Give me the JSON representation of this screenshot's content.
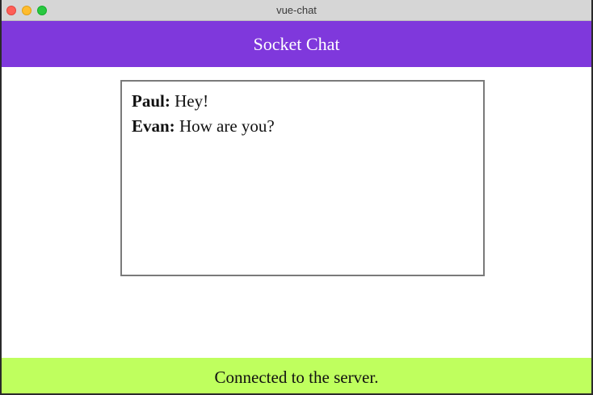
{
  "window": {
    "title": "vue-chat"
  },
  "header": {
    "title": "Socket Chat",
    "background": "#7f38dc"
  },
  "chat": {
    "messages": [
      {
        "sender": "Paul:",
        "text": " Hey!"
      },
      {
        "sender": "Evan:",
        "text": " How are you?"
      }
    ]
  },
  "status": {
    "text": "Connected to the server.",
    "background": "#bfff5e"
  }
}
